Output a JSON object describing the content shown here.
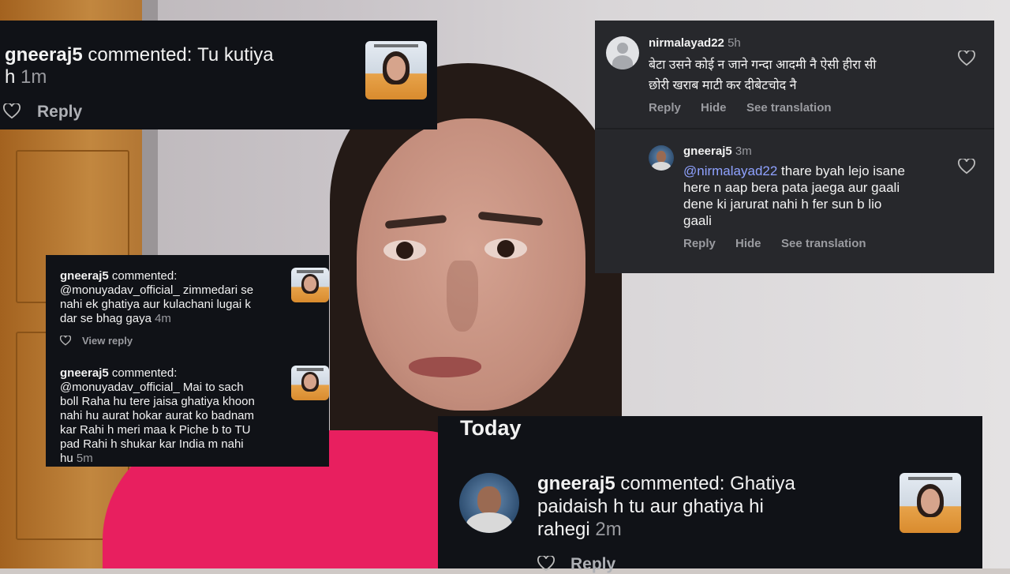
{
  "card_top_left": {
    "username": "gneeraj5",
    "verb": "commented:",
    "text_line1": "Tu kutiya",
    "text_line2": "h",
    "time": "1m",
    "reply": "Reply"
  },
  "card_top_right": {
    "username": "nirmalayad22",
    "time": "5h",
    "text_line1": "बेटा उसने कोई न जाने गन्दा आदमी नै ऐसी हीरा सी",
    "text_line2": "छोरी खराब माटी कर दीबेटचोद नै",
    "reply": "Reply",
    "hide": "Hide",
    "translate": "See translation",
    "sub_reply": {
      "username": "gneeraj5",
      "time": "3m",
      "mention": "@nirmalayad22",
      "text_line1": " thare byah lejo isane",
      "text_line2": "here n aap bera pata jaega aur gaali",
      "text_line3": "dene ki jarurat nahi h fer sun b lio",
      "text_line4": "gaali",
      "reply": "Reply",
      "hide": "Hide",
      "translate": "See translation"
    }
  },
  "card_mid_left": {
    "c1": {
      "username": "gneeraj5",
      "verb": "commented:",
      "line1": "@monuyadav_official_ zimmedari se",
      "line2": "nahi ek ghatiya aur kulachani lugai k",
      "line3": "dar se bhag gaya",
      "time": "4m",
      "view_reply": "View reply"
    },
    "c2": {
      "username": "gneeraj5",
      "verb": "commented:",
      "line1": "@monuyadav_official_ Mai to sach",
      "line2": "boll Raha hu tere jaisa ghatiya khoon",
      "line3": "nahi hu aurat hokar aurat ko badnam",
      "line4": "kar Rahi h meri maa k Piche b to TU",
      "line5": "pad Rahi h shukar kar India m nahi",
      "line6": "hu",
      "time": "5m"
    }
  },
  "card_bottom_right": {
    "header": "Today",
    "username": "gneeraj5",
    "verb": "commented:",
    "line1": "Ghatiya",
    "line2": "paidaish h tu aur ghatiya hi",
    "line3": "rahegi",
    "time": "2m",
    "reply": "Reply"
  },
  "colors": {
    "card_dark": "#101217",
    "card_gray": "#27282c",
    "mention": "#8fa2ff",
    "muted": "#9a9ba0",
    "shirt": "#e81f5f"
  },
  "icons": [
    "heart-icon",
    "default-avatar-icon"
  ]
}
